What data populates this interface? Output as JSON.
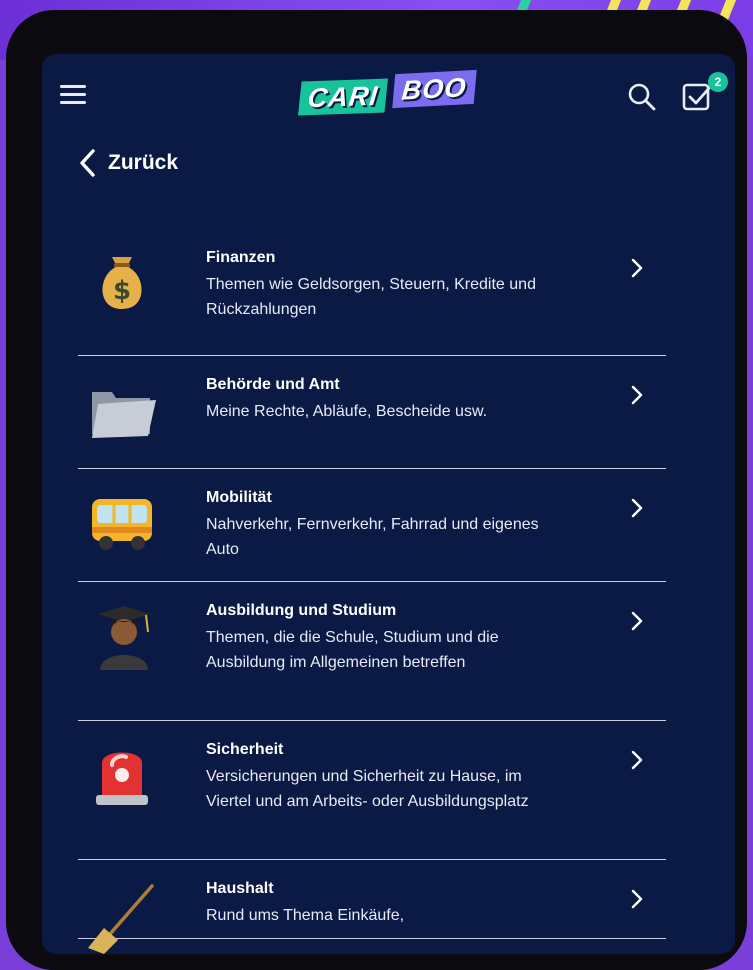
{
  "header": {
    "logo_part1": "CARI",
    "logo_part2": "BOO",
    "tasks_badge": "2"
  },
  "back": {
    "label": "Zurück"
  },
  "topics": [
    {
      "title": "Finanzen",
      "desc": "Themen wie Geldsorgen, Steuern, Kredite und Rückzahlungen",
      "icon": "money-bag-icon"
    },
    {
      "title": "Behörde und Amt",
      "desc": "Meine Rechte, Abläufe, Bescheide usw.",
      "icon": "folder-icon"
    },
    {
      "title": "Mobilität",
      "desc": "Nahverkehr, Fernverkehr, Fahrrad und eigenes Auto",
      "icon": "bus-icon"
    },
    {
      "title": "Ausbildung und Studium",
      "desc": "Themen, die die Schule, Studium und die Ausbildung im Allgemeinen betreffen",
      "icon": "graduate-icon"
    },
    {
      "title": "Sicherheit",
      "desc": "Versicherungen und Sicherheit zu Hause, im Viertel und am Arbeits- oder Ausbildungsplatz",
      "icon": "siren-icon"
    },
    {
      "title": "Haushalt",
      "desc": "Rund ums Thema Einkäufe,",
      "icon": "broom-icon"
    }
  ],
  "colors": {
    "screen_bg": "#0a1a44",
    "accent_green": "#17c39a",
    "accent_purple": "#7b6cf0",
    "outer_bg": "#7a3fd8"
  }
}
